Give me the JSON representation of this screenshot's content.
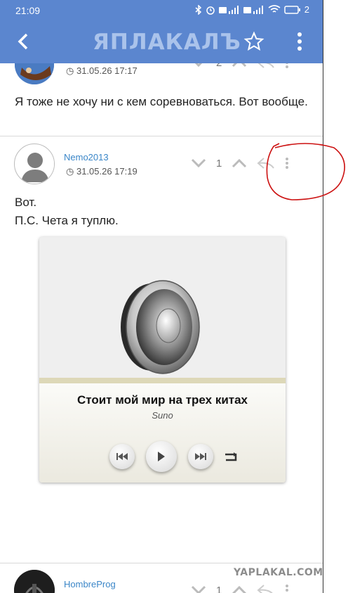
{
  "status_bar": {
    "time": "21:09",
    "battery": "2"
  },
  "header": {
    "logo": "ЯПЛАКАЛЪ",
    "back_icon": "chevron-left-icon",
    "favorite_icon": "star-icon",
    "menu_icon": "kebab-menu-icon"
  },
  "posts": [
    {
      "date": "31.05.26 17:17",
      "votes": "2",
      "text": "Я тоже не хочу ни с кем соревноваться. Вот вообще."
    },
    {
      "author": "Nemo2013",
      "date": "31.05.26 17:19",
      "votes": "1",
      "text_lines": [
        "Вот.",
        "П.С. Чета я туплю."
      ],
      "audio": {
        "title": "Стоит мой мир на трех китах",
        "artist": "Suno"
      }
    },
    {
      "author": "HombreProg",
      "votes": "1"
    }
  ],
  "watermark": "YAPLAKAL.COM",
  "colors": {
    "header_bg": "#5b86cf",
    "author_link": "#3a86c8",
    "annotation": "#cc1111"
  }
}
